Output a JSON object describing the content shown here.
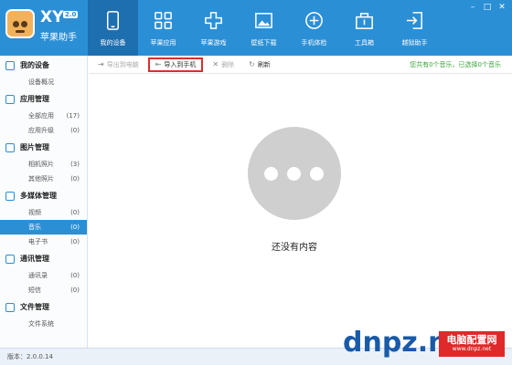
{
  "app": {
    "brand": "XY",
    "version_badge": "2.0",
    "name_cn": "苹果助手"
  },
  "nav": [
    {
      "label": "我的设备",
      "icon": "device-icon",
      "active": true
    },
    {
      "label": "苹果应用",
      "icon": "apps-grid-icon"
    },
    {
      "label": "苹果游戏",
      "icon": "gamepad-icon"
    },
    {
      "label": "壁纸下载",
      "icon": "wallpaper-icon"
    },
    {
      "label": "手机体检",
      "icon": "health-check-icon"
    },
    {
      "label": "工具箱",
      "icon": "toolbox-icon"
    },
    {
      "label": "越狱助手",
      "icon": "jailbreak-icon"
    }
  ],
  "sidebar": [
    {
      "group": "我的设备",
      "items": [
        {
          "label": "设备概况",
          "count": ""
        }
      ]
    },
    {
      "group": "应用管理",
      "items": [
        {
          "label": "全部应用",
          "count": "(17)"
        },
        {
          "label": "应用升级",
          "count": "(0)"
        }
      ]
    },
    {
      "group": "图片管理",
      "items": [
        {
          "label": "相机照片",
          "count": "(3)"
        },
        {
          "label": "其他照片",
          "count": "(0)"
        }
      ]
    },
    {
      "group": "多媒体管理",
      "items": [
        {
          "label": "视频",
          "count": "(0)"
        },
        {
          "label": "音乐",
          "count": "(0)",
          "active": true
        },
        {
          "label": "电子书",
          "count": "(0)"
        }
      ]
    },
    {
      "group": "通讯管理",
      "items": [
        {
          "label": "通讯录",
          "count": "(0)"
        },
        {
          "label": "短信",
          "count": "(0)"
        }
      ]
    },
    {
      "group": "文件管理",
      "items": [
        {
          "label": "文件系统",
          "count": ""
        }
      ]
    }
  ],
  "toolbar": {
    "export": "导出到电脑",
    "import": "导入到手机",
    "delete": "删除",
    "refresh": "刷新",
    "status": "您共有0个音乐，已选择0个音乐"
  },
  "empty_state": {
    "text": "还没有内容"
  },
  "status": {
    "version": "版本：2.0.0.14"
  },
  "watermark": {
    "logo": "dnpz.net",
    "cn": "电脑配置网",
    "url": "www.dnpz.net"
  },
  "colors": {
    "accent": "#2b8fd6",
    "highlight": "#d9302c",
    "status_green": "#3aa63a"
  }
}
